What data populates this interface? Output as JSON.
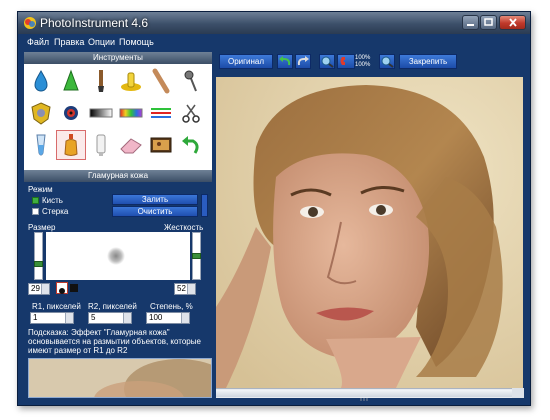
{
  "window": {
    "title": "PhotoInstrument 4.6",
    "controls": {
      "minimize": "minimize-icon",
      "maximize": "maximize-icon",
      "close": "close-icon"
    }
  },
  "menu": {
    "items": [
      "Файл",
      "Правка",
      "Опции",
      "Помощь"
    ]
  },
  "tools_panel": {
    "title": "Инструменты",
    "tools": [
      {
        "name": "blur-drop-tool",
        "icon": "water-drop-icon"
      },
      {
        "name": "sharpen-cone-tool",
        "icon": "green-cone-icon"
      },
      {
        "name": "brush-tool",
        "icon": "paint-brush-icon"
      },
      {
        "name": "soap-tool",
        "icon": "yellow-soap-icon"
      },
      {
        "name": "smudge-stick-tool",
        "icon": "stick-icon"
      },
      {
        "name": "pin-tool",
        "icon": "pin-icon"
      },
      {
        "name": "redeye-tool",
        "icon": "shield-icon"
      },
      {
        "name": "eye-tool",
        "icon": "eye-icon"
      },
      {
        "name": "gradient-tool",
        "icon": "gradient-bar-icon"
      },
      {
        "name": "color-bar-tool",
        "icon": "rainbow-bar-icon"
      },
      {
        "name": "lines-tool",
        "icon": "color-lines-icon"
      },
      {
        "name": "clone-cut-tool",
        "icon": "scissors-icon"
      },
      {
        "name": "liquid-tool",
        "icon": "test-tube-icon"
      },
      {
        "name": "glamour-skin-tool",
        "icon": "perfume-bottle-icon"
      },
      {
        "name": "tube-tool",
        "icon": "tube-icon"
      },
      {
        "name": "eraser-tool",
        "icon": "eraser-icon"
      },
      {
        "name": "image-tool",
        "icon": "picture-icon"
      },
      {
        "name": "undo-tool",
        "icon": "undo-arrow-icon"
      }
    ]
  },
  "effect_panel": {
    "title": "Гламурная кожа",
    "mode_label": "Режим",
    "mode_brush": "Кисть",
    "mode_eraser": "Стерка",
    "fill_button": "Залить",
    "clear_button": "Очистить",
    "size_label": "Размер",
    "hardness_label": "Жесткость",
    "size_value": "29",
    "hardness_value": "52",
    "r1_label": "R1, пикселей",
    "r2_label": "R2, пикселей",
    "degree_label": "Степень, %",
    "r1_value": "1",
    "r2_value": "5",
    "degree_value": "100",
    "hint": "Подсказка: Эффект \"Гламурная кожа\" основывается на размытии объектов, которые имеют размер от R1 до R2"
  },
  "toolbar": {
    "original_button": "Оригинал",
    "commit_button": "Закрепить",
    "zoom_top": "100%",
    "zoom_bottom": "100%"
  }
}
